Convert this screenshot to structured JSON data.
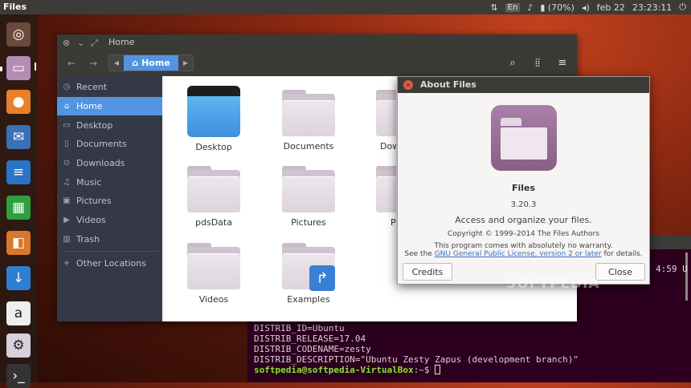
{
  "topbar": {
    "app": "Files",
    "lang": "En",
    "battery": "(70%)",
    "date": "feb 22",
    "time": "23:23:11"
  },
  "launcher": [
    {
      "name": "ubuntu-logo-icon",
      "glyph": "◎",
      "color": "#6b4a3e"
    },
    {
      "name": "files-icon",
      "glyph": "▭",
      "color": "#b48db5"
    },
    {
      "name": "firefox-icon",
      "glyph": "●",
      "color": "#e8802a"
    },
    {
      "name": "thunderbird-icon",
      "glyph": "✉",
      "color": "#3b6fb6"
    },
    {
      "name": "writer-icon",
      "glyph": "≡",
      "color": "#2a73c7"
    },
    {
      "name": "calc-icon",
      "glyph": "▦",
      "color": "#2e9e3e"
    },
    {
      "name": "impress-icon",
      "glyph": "◧",
      "color": "#d9772a"
    },
    {
      "name": "software-center-icon",
      "glyph": "↓",
      "color": "#2f7fd1"
    },
    {
      "name": "amazon-icon",
      "glyph": "a",
      "color": "#eeeeee"
    },
    {
      "name": "settings-icon",
      "glyph": "⚙",
      "color": "#d9d0dc"
    },
    {
      "name": "terminal-icon",
      "glyph": "›_",
      "color": "#333333"
    }
  ],
  "files": {
    "title": "Home",
    "crumb": "Home",
    "sidebar": [
      "Recent",
      "Home",
      "Desktop",
      "Documents",
      "Downloads",
      "Music",
      "Pictures",
      "Videos",
      "Trash",
      "Other Locations"
    ],
    "items": [
      "Desktop",
      "Documents",
      "Dow",
      "pdsData",
      "Pictures",
      "P",
      "Videos",
      "Examples"
    ]
  },
  "about": {
    "title": "About Files",
    "name": "Files",
    "version": "3.20.3",
    "desc": "Access and organize your files.",
    "copyright": "Copyright © 1999–2014 The Files Authors",
    "warranty": "This program comes with absolutely no warranty.",
    "license_pre": "See the",
    "license_link": "GNU General Public License, version 2 or later",
    "license_post": "for details.",
    "credits": "Credits",
    "close": "Close"
  },
  "terminal": {
    "lines": [
      "DISTRIB_ID=Ubuntu",
      "DISTRIB_RELEASE=17.04",
      "DISTRIB_CODENAME=zesty",
      "DISTRIB_DESCRIPTION=\"Ubuntu Zesty Zapus (development branch)\""
    ],
    "prompt_user": "softpedia@softpedia-VirtualBox",
    "prompt_path": ":~$ ",
    "side": "4:59 U"
  },
  "watermark": "SOFTPEDIA",
  "colors": {
    "accent": "#5294e2",
    "sidebar": "#353945",
    "close": "#e25a3a",
    "prompt": "#8ae234"
  }
}
